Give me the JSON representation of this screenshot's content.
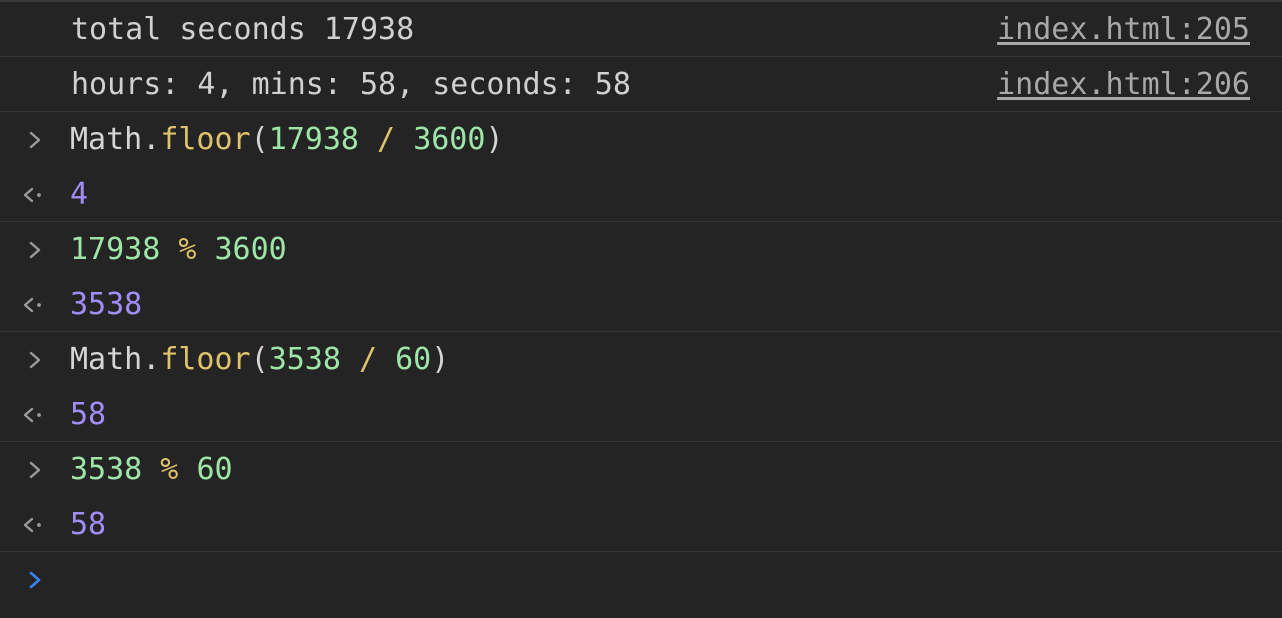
{
  "logs": [
    {
      "message": "total seconds 17938",
      "source": "index.html:205"
    },
    {
      "message": "hours: 4, mins: 58, seconds: 58",
      "source": "index.html:206"
    }
  ],
  "entries": [
    {
      "input": {
        "obj": "Math.",
        "fn": "floor",
        "open": "(",
        "a": "17938",
        "op": " / ",
        "b": "3600",
        "close": ")"
      },
      "result": "4"
    },
    {
      "input": {
        "a": "17938",
        "op": " % ",
        "b": "3600"
      },
      "result": "3538"
    },
    {
      "input": {
        "obj": "Math.",
        "fn": "floor",
        "open": "(",
        "a": "3538",
        "op": " / ",
        "b": "60",
        "close": ")"
      },
      "result": "58"
    },
    {
      "input": {
        "a": "3538",
        "op": " % ",
        "b": "60"
      },
      "result": "58"
    }
  ],
  "colors": {
    "background": "#242424",
    "separator": "#363636",
    "plain_text": "#d5d5d5",
    "function": "#dfc36a",
    "number": "#9ee6a8",
    "result": "#a28cf8",
    "prompt_active": "#3b82f6",
    "gutter_icon": "#9a9a9a"
  },
  "icons": {
    "input_marker": "chevron-right-icon",
    "result_marker": "return-arrow-icon",
    "prompt": "chevron-right-icon"
  }
}
